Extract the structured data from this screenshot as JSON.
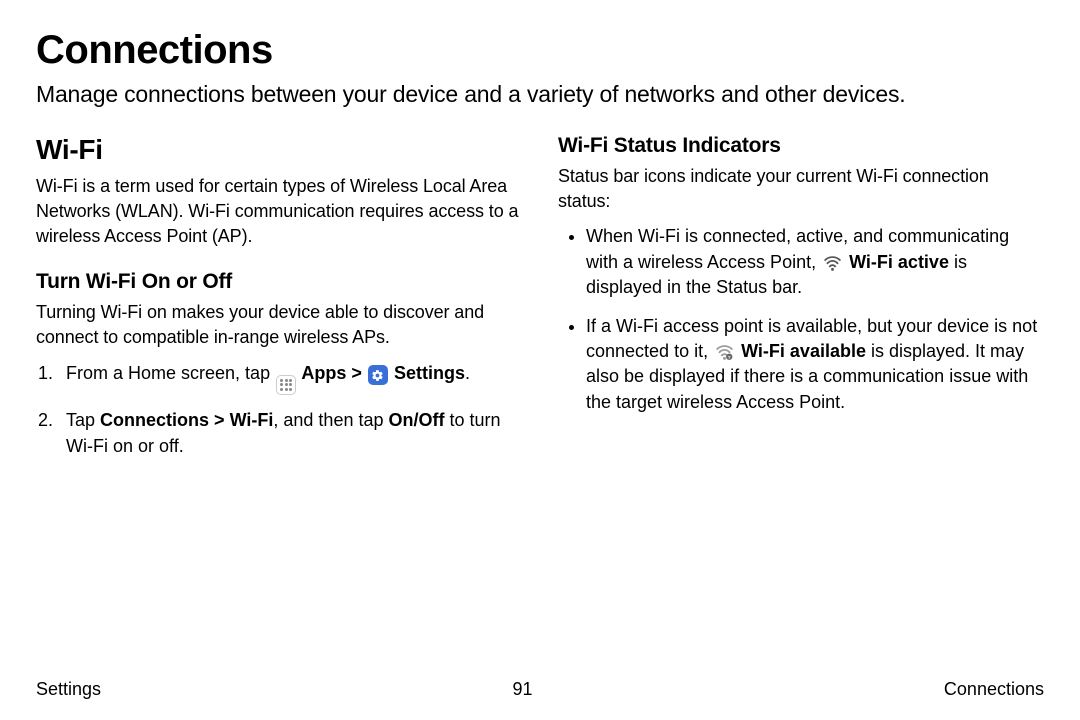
{
  "title": "Connections",
  "intro": "Manage connections between your device and a variety of networks and other devices.",
  "left": {
    "h2": "Wi-Fi",
    "p1": "Wi-Fi is a term used for certain types of Wireless Local Area Networks (WLAN). Wi-Fi communication requires access to a wireless Access Point (AP).",
    "h3": "Turn Wi-Fi On or Off",
    "p2": "Turning Wi-Fi on makes your device able to discover and connect to compatible in-range wireless APs.",
    "step1_pre": "From a Home screen, tap ",
    "step1_apps": " Apps ",
    "step1_chev": ">",
    "step1_settings": " Settings",
    "step1_post": ".",
    "step2_a": "Tap ",
    "step2_b": "Connections ",
    "step2_c": ">",
    "step2_d": " Wi-Fi",
    "step2_e": ", and then tap ",
    "step2_f": "On/Off",
    "step2_g": " to turn Wi-Fi on or off."
  },
  "right": {
    "h3": "Wi-Fi Status Indicators",
    "p1": "Status bar icons indicate your current Wi-Fi connection status:",
    "b1_a": "When Wi-Fi is connected, active, and communicating with a wireless Access Point, ",
    "b1_b": " Wi-Fi active",
    "b1_c": " is displayed in the Status bar.",
    "b2_a": "If a Wi-Fi access point is available, but your device is not connected to it, ",
    "b2_b": " Wi-Fi available",
    "b2_c": " is displayed. It may also be displayed if there is a communication issue with the target wireless Access Point."
  },
  "footer": {
    "left": "Settings",
    "center": "91",
    "right": "Connections"
  }
}
